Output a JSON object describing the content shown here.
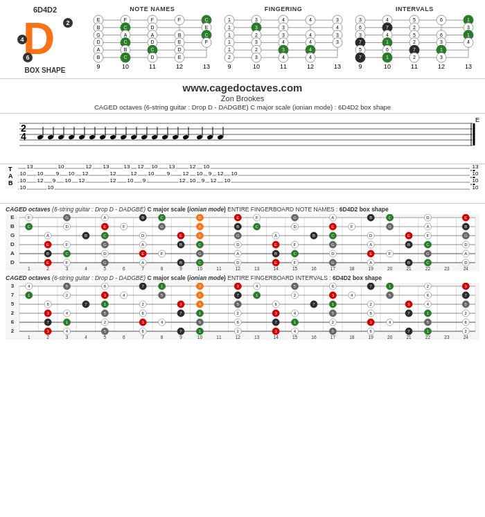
{
  "header": {
    "tuning": "6D4D2",
    "box_shape": "BOX SHAPE",
    "website": "www.cagedoctaves.com",
    "author": "Zon Brookes",
    "description": "CAGED octaves (6-string guitar : Drop D - DADGBE) C major scale (ionian mode) : 6D4D2 box shape"
  },
  "diagrams": {
    "note_names": {
      "title": "NOTE NAMES",
      "frets": [
        9,
        10,
        11,
        12,
        13
      ]
    },
    "fingering": {
      "title": "FINGERING",
      "frets": [
        9,
        10,
        11,
        12,
        13
      ]
    },
    "intervals": {
      "title": "INTERVALS",
      "frets": [
        9,
        10,
        11,
        12,
        13
      ]
    }
  },
  "fingerboard1": {
    "label": "CAGED octaves (6-string guitar : Drop D - DADGBE) C major scale (ionian mode) ENTIRE FINGERBOARD NOTE NAMES : 6D4D2 box shape"
  },
  "fingerboard2": {
    "label": "CAGED octaves (6-string guitar : Drop D - DADGBE) C major scale (ionian mode) ENTIRE FINGERBOARD INTERVALS : 6D4D2 box shape"
  }
}
